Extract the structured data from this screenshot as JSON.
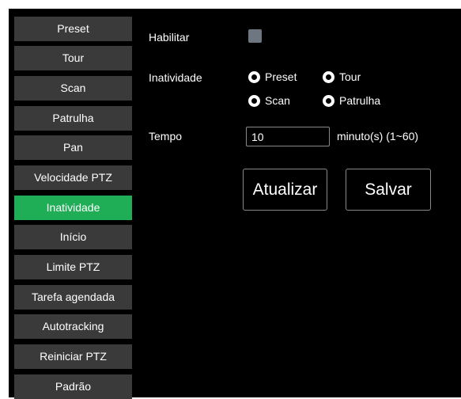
{
  "sidebar": {
    "items": [
      {
        "label": "Preset"
      },
      {
        "label": "Tour"
      },
      {
        "label": "Scan"
      },
      {
        "label": "Patrulha"
      },
      {
        "label": "Pan"
      },
      {
        "label": "Velocidade PTZ"
      },
      {
        "label": "Inatividade"
      },
      {
        "label": "Início"
      },
      {
        "label": "Limite PTZ"
      },
      {
        "label": "Tarefa agendada"
      },
      {
        "label": "Autotracking"
      },
      {
        "label": "Reiniciar PTZ"
      },
      {
        "label": "Padrão"
      }
    ],
    "active_index": 6
  },
  "form": {
    "enable_label": "Habilitar",
    "enable_checked": false,
    "inactivity_label": "Inatividade",
    "options": [
      {
        "label": "Preset"
      },
      {
        "label": "Tour"
      },
      {
        "label": "Scan"
      },
      {
        "label": "Patrulha"
      }
    ],
    "time_label": "Tempo",
    "time_value": "10",
    "time_hint": "minuto(s) (1~60)"
  },
  "buttons": {
    "refresh_label": "Atualizar",
    "save_label": "Salvar"
  },
  "colors": {
    "background": "#000000",
    "sidebar_item": "#3a3a3a",
    "accent_active": "#1fad55",
    "checkbox": "#6e7780",
    "border": "#8a8a8a"
  }
}
